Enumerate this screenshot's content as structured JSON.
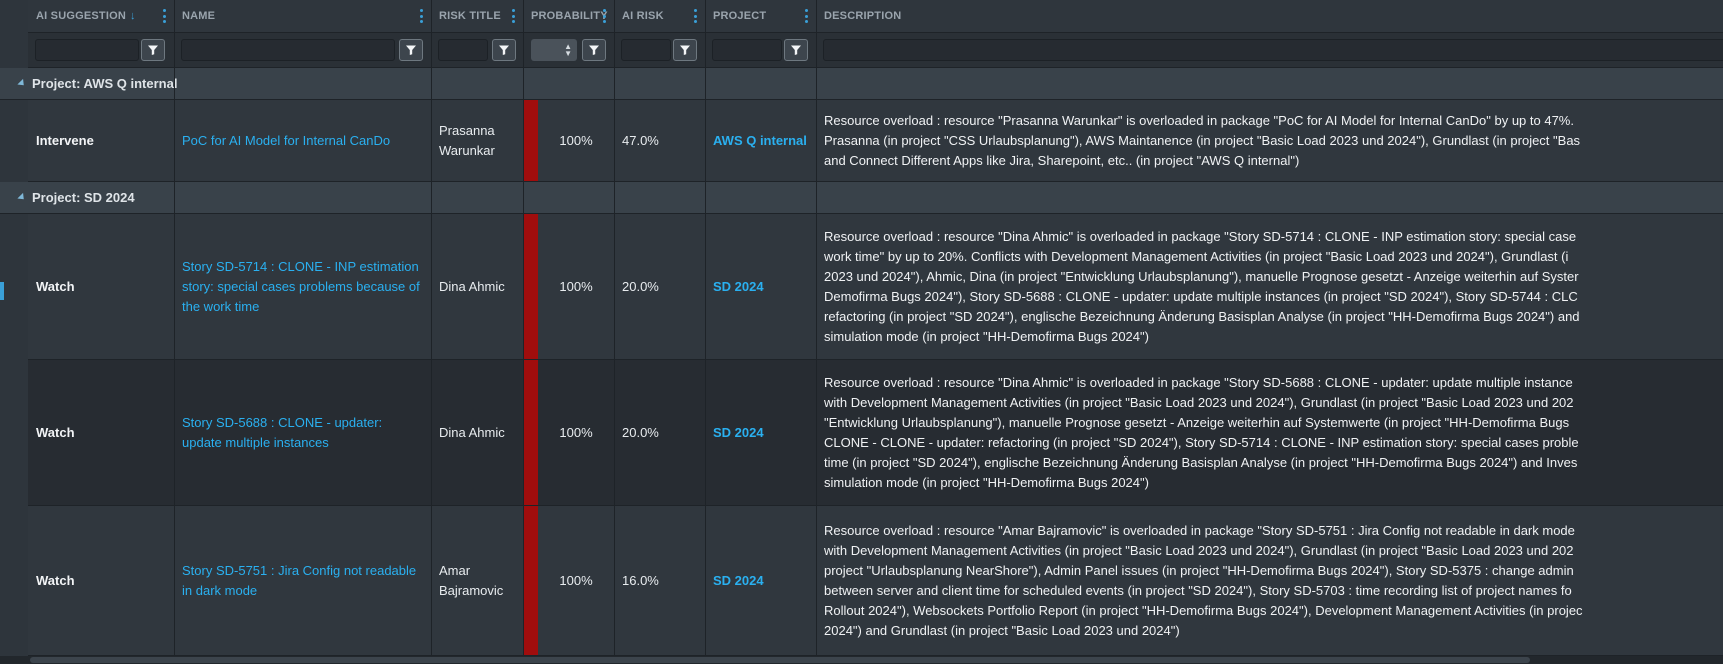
{
  "columns": {
    "ai_suggestion": "AI SUGGESTION",
    "ai_suggestion_sort": "↓",
    "name": "NAME",
    "risk_title": "RISK TITLE",
    "probability": "PROBABILITY",
    "ai_risk": "AI RISK",
    "project": "PROJECT",
    "description": "DESCRIPTION"
  },
  "icons": {
    "sort": "arrow-down-icon",
    "menu": "kebab-menu-icon",
    "filter": "filter-icon",
    "collapse": "collapse-triangle-icon"
  },
  "colors": {
    "accent": "#2ab0f0",
    "risk_bar": "#a00d0d",
    "header_bg": "#2f363d"
  },
  "groups": [
    {
      "label": "Project: AWS Q internal",
      "rows": [
        {
          "suggestion": "Intervene",
          "name_lines": [
            "PoC for AI Model for Internal CanDo"
          ],
          "risk_lines": [
            "Prasanna",
            "Warunkar"
          ],
          "probability": "100%",
          "ai_risk": "47.0%",
          "project": "AWS Q internal",
          "description_lines": [
            "Resource overload : resource \"Prasanna Warunkar\" is overloaded in package \"PoC for AI Model for Internal CanDo\" by up to 47%.",
            "Prasanna (in project \"CSS Urlaubsplanung\"), AWS Maintanence (in project \"Basic Load 2023 und 2024\"), Grundlast (in project \"Bas",
            "and Connect Different Apps like Jira, Sharepoint, etc.. (in project \"AWS Q internal\")"
          ]
        }
      ]
    },
    {
      "label": "Project: SD 2024",
      "rows": [
        {
          "suggestion": "Watch",
          "name_lines": [
            "Story SD-5714 : CLONE - INP estimation",
            "story: special cases problems because of",
            "the work time"
          ],
          "risk_lines": [
            "Dina Ahmic"
          ],
          "probability": "100%",
          "ai_risk": "20.0%",
          "project": "SD 2024",
          "description_lines": [
            "Resource overload : resource \"Dina Ahmic\" is overloaded in package \"Story SD-5714 : CLONE - INP estimation story: special case",
            "work time\" by up to 20%. Conflicts with Development Management Activities (in project \"Basic Load 2023 und 2024\"), Grundlast (i",
            "2023 und 2024\"), Ahmic, Dina (in project \"Entwicklung Urlaubsplanung\"), manuelle Prognose gesetzt - Anzeige weiterhin auf Syster",
            "Demofirma Bugs 2024\"), Story SD-5688 : CLONE - updater: update multiple instances (in project \"SD 2024\"), Story SD-5744 : CLC",
            "refactoring (in project \"SD 2024\"), englische Bezeichnung Änderung Basisplan Analyse (in project \"HH-Demofirma Bugs 2024\") and",
            "simulation mode (in project \"HH-Demofirma Bugs 2024\")"
          ]
        },
        {
          "suggestion": "Watch",
          "name_lines": [
            "Story SD-5688 : CLONE - updater:",
            "update multiple instances"
          ],
          "risk_lines": [
            "Dina Ahmic"
          ],
          "probability": "100%",
          "ai_risk": "20.0%",
          "project": "SD 2024",
          "description_lines": [
            "Resource overload : resource \"Dina Ahmic\" is overloaded in package \"Story SD-5688 : CLONE - updater: update multiple instance",
            "with Development Management Activities (in project \"Basic Load 2023 und 2024\"), Grundlast (in project \"Basic Load 2023 und 202",
            "\"Entwicklung Urlaubsplanung\"), manuelle Prognose gesetzt - Anzeige weiterhin auf Systemwerte (in project \"HH-Demofirma Bugs",
            "CLONE - CLONE - updater: refactoring (in project \"SD 2024\"), Story SD-5714 : CLONE - INP estimation story: special cases proble",
            "time (in project \"SD 2024\"), englische Bezeichnung Änderung Basisplan Analyse (in project \"HH-Demofirma Bugs 2024\") and Inves",
            "simulation mode (in project \"HH-Demofirma Bugs 2024\")"
          ]
        },
        {
          "suggestion": "Watch",
          "name_lines": [
            "Story SD-5751 : Jira Config not readable",
            "in dark mode"
          ],
          "risk_lines": [
            "Amar",
            "Bajramovic"
          ],
          "probability": "100%",
          "ai_risk": "16.0%",
          "project": "SD 2024",
          "description_lines": [
            "Resource overload : resource \"Amar Bajramovic\" is overloaded in package \"Story SD-5751 : Jira Config not readable in dark mode",
            "with Development Management Activities (in project \"Basic Load 2023 und 2024\"), Grundlast (in project \"Basic Load 2023 und 202",
            "project \"Urlaubsplanung NearShore\"), Admin Panel issues (in project \"HH-Demofirma Bugs 2024\"), Story SD-5375 : change admin",
            "between server and client time for scheduled events (in project \"SD 2024\"), Story SD-5703 : time recording list of project names fo",
            "Rollout 2024\"), Websockets Portfolio Report (in project \"HH-Demofirma Bugs 2024\"), Development Management Activities (in projec",
            "2024\") and Grundlast (in project \"Basic Load 2023 und 2024\")"
          ]
        }
      ]
    }
  ]
}
